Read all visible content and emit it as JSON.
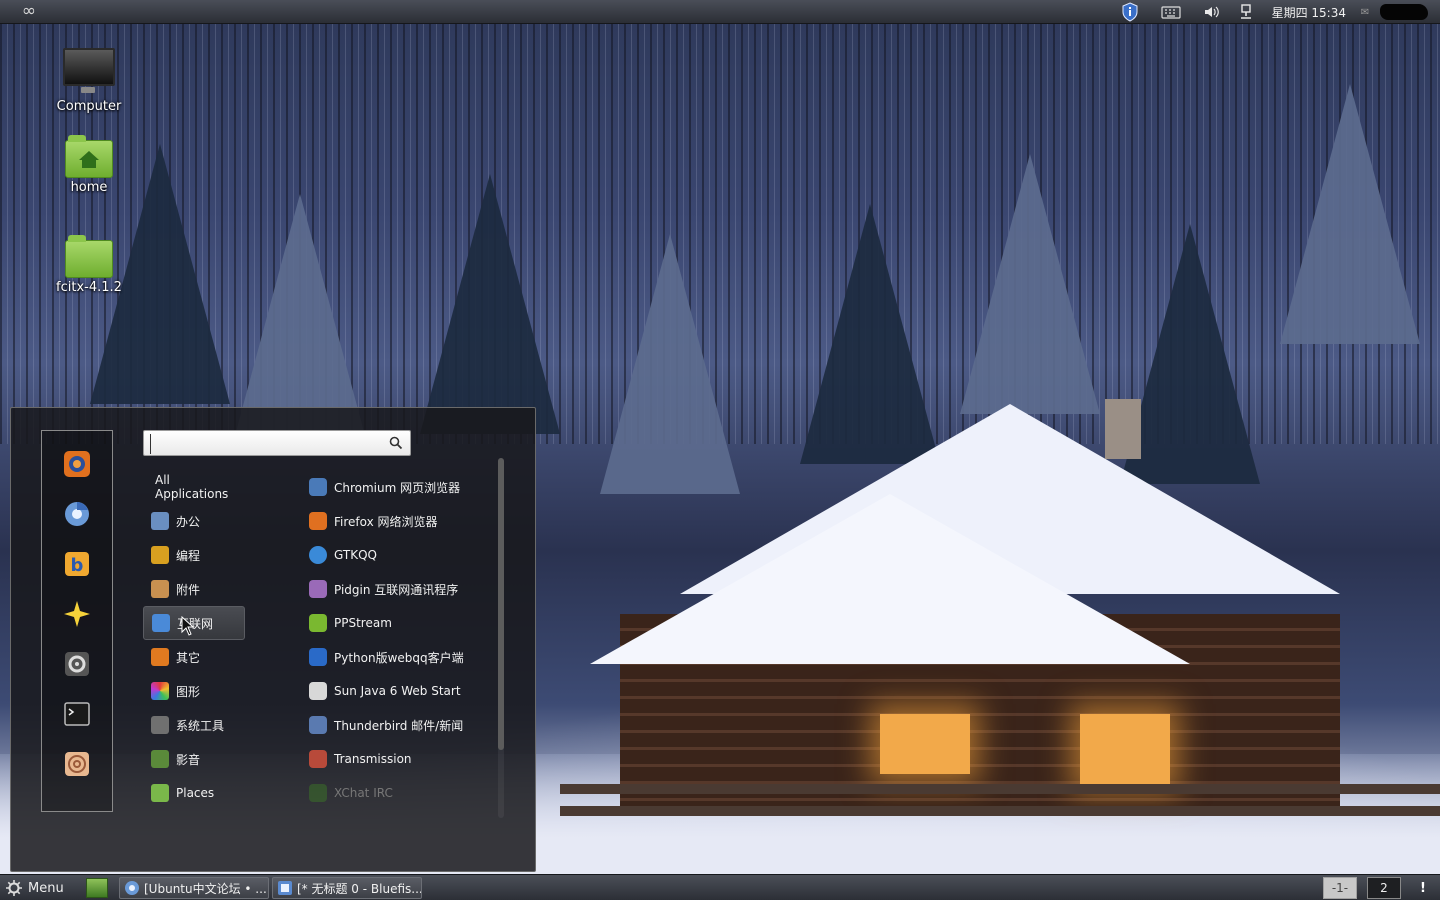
{
  "top_panel": {
    "clock": "星期四 15:34",
    "icons": [
      "infinity-icon",
      "shield-info-icon",
      "keyboard-icon",
      "volume-icon",
      "network-icon",
      "mail-icon"
    ]
  },
  "desktop_icons": [
    {
      "label": "Computer",
      "icon": "computer-icon"
    },
    {
      "label": "home",
      "icon": "home-folder-icon"
    },
    {
      "label": "fcitx-4.1.2",
      "icon": "folder-icon"
    }
  ],
  "menu": {
    "favorites": [
      "firefox-icon",
      "chromium-icon",
      "bluefish-icon",
      "sparkle-icon",
      "settings-icon",
      "terminal-icon",
      "nautilus-icon"
    ],
    "search": {
      "value": "",
      "placeholder": ""
    },
    "categories": [
      {
        "label": "All Applications",
        "icon": ""
      },
      {
        "label": "办公",
        "icon": "office-icon",
        "color": "#6a8fc0"
      },
      {
        "label": "编程",
        "icon": "programming-icon",
        "color": "#d8a020"
      },
      {
        "label": "附件",
        "icon": "accessories-icon",
        "color": "#c89050"
      },
      {
        "label": "互联网",
        "icon": "internet-icon",
        "color": "#4a8ad8"
      },
      {
        "label": "其它",
        "icon": "other-icon",
        "color": "#e07a20"
      },
      {
        "label": "图形",
        "icon": "graphics-icon",
        "color": "#d04aa0"
      },
      {
        "label": "系统工具",
        "icon": "system-tools-icon",
        "color": "#707070"
      },
      {
        "label": "影音",
        "icon": "multimedia-icon",
        "color": "#5a8a3a"
      },
      {
        "label": "Places",
        "icon": "places-folder-icon",
        "color": "#7ab84a"
      }
    ],
    "selected_category": "互联网",
    "apps": [
      {
        "label": "Chromium 网页浏览器",
        "icon": "chromium-icon",
        "color": "#4a7ab8"
      },
      {
        "label": "Firefox 网络浏览器",
        "icon": "firefox-icon",
        "color": "#e07020"
      },
      {
        "label": "GTKQQ",
        "icon": "gtkqq-icon",
        "color": "#3a8ad8"
      },
      {
        "label": "Pidgin 互联网通讯程序",
        "icon": "pidgin-icon",
        "color": "#9a6ab8"
      },
      {
        "label": "PPStream",
        "icon": "ppstream-icon",
        "color": "#7ab830"
      },
      {
        "label": "Python版webqq客户端",
        "icon": "webqq-icon",
        "color": "#2a6ac8"
      },
      {
        "label": "Sun Java 6 Web Start",
        "icon": "java-icon",
        "color": "#d8d8d8"
      },
      {
        "label": "Thunderbird 邮件/新闻",
        "icon": "thunderbird-icon",
        "color": "#5a7ab0"
      },
      {
        "label": "Transmission",
        "icon": "transmission-icon",
        "color": "#b84a3a"
      },
      {
        "label": "XChat IRC",
        "icon": "xchat-icon",
        "color": "#3a6a2a"
      }
    ]
  },
  "bottom_panel": {
    "menu_label": "Menu",
    "tasks": [
      {
        "label": "[Ubuntu中文论坛 • ...",
        "icon": "chromium-icon"
      },
      {
        "label": "[* 无标题 0 - Bluefis...",
        "icon": "bluefish-icon"
      }
    ],
    "workspaces": [
      "-1-",
      "2"
    ],
    "notify": "!"
  }
}
